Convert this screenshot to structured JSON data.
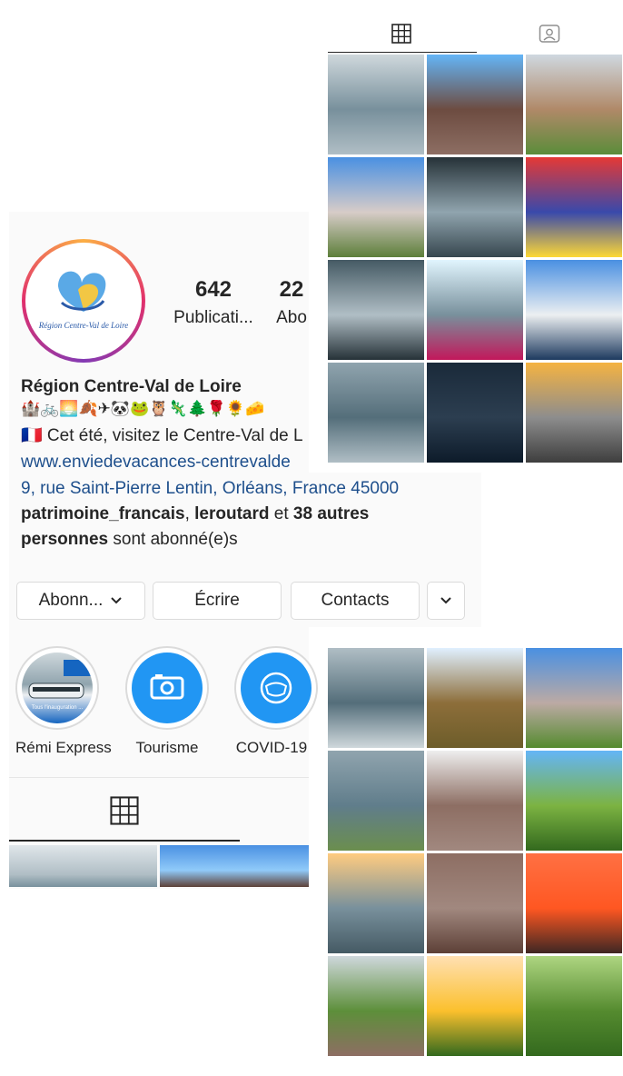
{
  "top_grid": {
    "tabs": [
      {
        "icon": "grid-icon"
      },
      {
        "icon": "tagged-icon"
      }
    ],
    "photos": [
      {
        "name": "train-photo",
        "colors": [
          "#cfd8dc",
          "#78909c",
          "#b0bec5"
        ]
      },
      {
        "name": "boat-mast-photo",
        "colors": [
          "#64b5f6",
          "#6d4c41",
          "#8d6e63"
        ]
      },
      {
        "name": "castle-tower-photo",
        "colors": [
          "#cfd8e0",
          "#b08968",
          "#5b8c3a"
        ]
      },
      {
        "name": "white-tower-photo",
        "colors": [
          "#4a90e2",
          "#d7ccc8",
          "#5d7f3a"
        ]
      },
      {
        "name": "ornate-facade-photo",
        "colors": [
          "#263238",
          "#90a4ae",
          "#37474f"
        ]
      },
      {
        "name": "street-art-photo",
        "colors": [
          "#e53935",
          "#3949ab",
          "#fdd835"
        ]
      },
      {
        "name": "glass-roof-photo",
        "colors": [
          "#455a64",
          "#b0bec5",
          "#263238"
        ]
      },
      {
        "name": "chateau-flowers-photo",
        "colors": [
          "#e1f5fe",
          "#78909c",
          "#c2185b"
        ]
      },
      {
        "name": "chateau-reflection-photo",
        "colors": [
          "#4a90e2",
          "#eceff1",
          "#1e3a5f"
        ]
      },
      {
        "name": "river-boat-photo",
        "colors": [
          "#90a4ae",
          "#546e7a",
          "#b0bec5"
        ]
      },
      {
        "name": "starry-sky-photo",
        "colors": [
          "#1a2a3a",
          "#2c3e50",
          "#0d1b2a"
        ]
      },
      {
        "name": "sunset-birds-photo",
        "colors": [
          "#f5b342",
          "#8d8d8d",
          "#3e3e3e"
        ]
      }
    ]
  },
  "profile": {
    "logo_text": "Région Centre-Val de Loire",
    "stats": [
      {
        "value": "642",
        "label": "Publicati..."
      },
      {
        "value": "22",
        "label": "Abo"
      }
    ],
    "name": "Région Centre-Val de Loire",
    "emoji_line": "🏰🚲🌅🍂✈🐼🐸🦉🦎🌲🌹🌻🧀",
    "bio_line": "🇫🇷 Cet été, visitez le Centre-Val de L",
    "link": "www.enviedevacances-centrevalde",
    "address": "9, rue Saint-Pierre Lentin, Orléans, France 45000",
    "followed_by": {
      "name1": "patrimoine_francais",
      "sep": ", ",
      "name2": "leroutard",
      "mid": " et ",
      "others": "38 autres",
      "others2": "personnes",
      "tail": " sont abonné(e)s"
    },
    "buttons": {
      "follow": "Abonn...",
      "message": "Écrire",
      "contacts": "Contacts"
    },
    "highlights": [
      {
        "label": "Rémi Express",
        "badge": "Tous l'inauguration ..."
      },
      {
        "label": "Tourisme"
      },
      {
        "label": "COVID-19"
      }
    ],
    "tab_icon": "grid-icon"
  },
  "bottom_grid": {
    "photos": [
      {
        "name": "reflection-facade-photo",
        "colors": [
          "#b0bec5",
          "#546e7a",
          "#cfd8dc"
        ]
      },
      {
        "name": "sunflower-field-photo",
        "colors": [
          "#e0f0ff",
          "#8d6e3a",
          "#6d5d2a"
        ]
      },
      {
        "name": "chateau-garden-photo",
        "colors": [
          "#4a90e2",
          "#bcaaa4",
          "#558b2f"
        ]
      },
      {
        "name": "river-boats-photo",
        "colors": [
          "#90a4ae",
          "#607d8b",
          "#6b8e4e"
        ]
      },
      {
        "name": "old-houses-photo",
        "colors": [
          "#eeeeee",
          "#8d6e63",
          "#a1887f"
        ]
      },
      {
        "name": "garden-church-photo",
        "colors": [
          "#64b5f6",
          "#7cb342",
          "#33691e"
        ]
      },
      {
        "name": "cathedral-city-photo",
        "colors": [
          "#ffcc80",
          "#78909c",
          "#455a64"
        ]
      },
      {
        "name": "town-aerial-photo",
        "colors": [
          "#8d6e63",
          "#a1887f",
          "#5d4037"
        ]
      },
      {
        "name": "sunset-river-photo",
        "colors": [
          "#ff7043",
          "#ff5722",
          "#3e2723"
        ]
      },
      {
        "name": "village-bridge-photo",
        "colors": [
          "#cfd8dc",
          "#5d8f3a",
          "#8d6e63"
        ]
      },
      {
        "name": "balloon-sunflowers-photo",
        "colors": [
          "#ffe0b2",
          "#fbc02d",
          "#33691e"
        ]
      },
      {
        "name": "forest-pond-photo",
        "colors": [
          "#aed581",
          "#558b2f",
          "#33691e"
        ]
      }
    ]
  }
}
